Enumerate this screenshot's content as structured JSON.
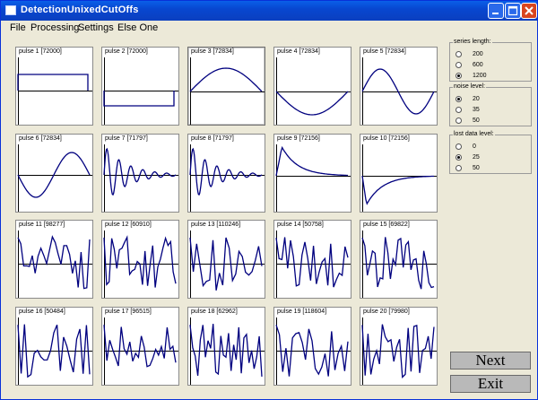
{
  "window": {
    "title": "DetectionUnixedCutOffs"
  },
  "menu": [
    "File",
    "Processing",
    "Settings",
    "Else One"
  ],
  "pulses": [
    {
      "label": "pulse 1 [72000]"
    },
    {
      "label": "pulse 2 [72000]"
    },
    {
      "label": "pulse 3 [72834]"
    },
    {
      "label": "pulse 4 [72834]"
    },
    {
      "label": "pulse 5 [72834]"
    },
    {
      "label": "pulse 6 [72834]"
    },
    {
      "label": "pulse 7 [71797]"
    },
    {
      "label": "pulse 8 [71797]"
    },
    {
      "label": "pulse 9 [72156]"
    },
    {
      "label": "pulse 10 [72156]"
    },
    {
      "label": "pulse 11 [98277]"
    },
    {
      "label": "pulse 12 [60910]"
    },
    {
      "label": "pulse 13 [110246]"
    },
    {
      "label": "pulse 14 [50758]"
    },
    {
      "label": "pulse 15 [69822]"
    },
    {
      "label": "pulse 16 [50484]"
    },
    {
      "label": "pulse 17 [96515]"
    },
    {
      "label": "pulse 18 [62962]"
    },
    {
      "label": "pulse 19 [118604]"
    },
    {
      "label": "pulse 20 [79980]"
    }
  ],
  "settings": {
    "series_length": {
      "title": "series length:",
      "options": [
        "200",
        "600",
        "1200"
      ],
      "selected": "1200"
    },
    "noise_level": {
      "title": "noise level:",
      "options": [
        "20",
        "35",
        "50"
      ],
      "selected": "20"
    },
    "lost_data_level": {
      "title": "lost data level:",
      "options": [
        "0",
        "25",
        "50"
      ],
      "selected": "25"
    }
  },
  "buttons": {
    "next": "Next",
    "exit": "Exit"
  },
  "colors": {
    "plot_line": "#00007f",
    "title_bar": "#0a52df",
    "close_button": "#d9451f"
  }
}
